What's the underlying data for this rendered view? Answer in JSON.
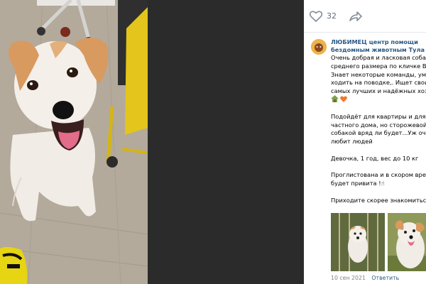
{
  "actions": {
    "like_count": "32"
  },
  "post": {
    "author_line1": "ЛЮБИМЕЦ центр помощи",
    "author_line2": "бездомным животным Тула",
    "lines": [
      "Очень добрая и ласковая собачка",
      "среднего размера по кличке Виви",
      "Знает некоторые команды, умеет",
      "ходить на поводке,. Ищет своих",
      "самых лучших и надёжных хозяев"
    ],
    "para2": [
      "Подойдёт для квартиры и для",
      "частного дома, но сторожевой",
      "собакой вряд ли будет...Уж очень",
      "любит людей"
    ],
    "para3": "Девочка, 1 год, вес до 10 кг",
    "para4": [
      "Проглистована и в скором времени",
      "будет привита !☝"
    ],
    "para5": "Приходите скорее знакомиться!",
    "date": "10 сен 2021",
    "reply": "Ответить"
  }
}
